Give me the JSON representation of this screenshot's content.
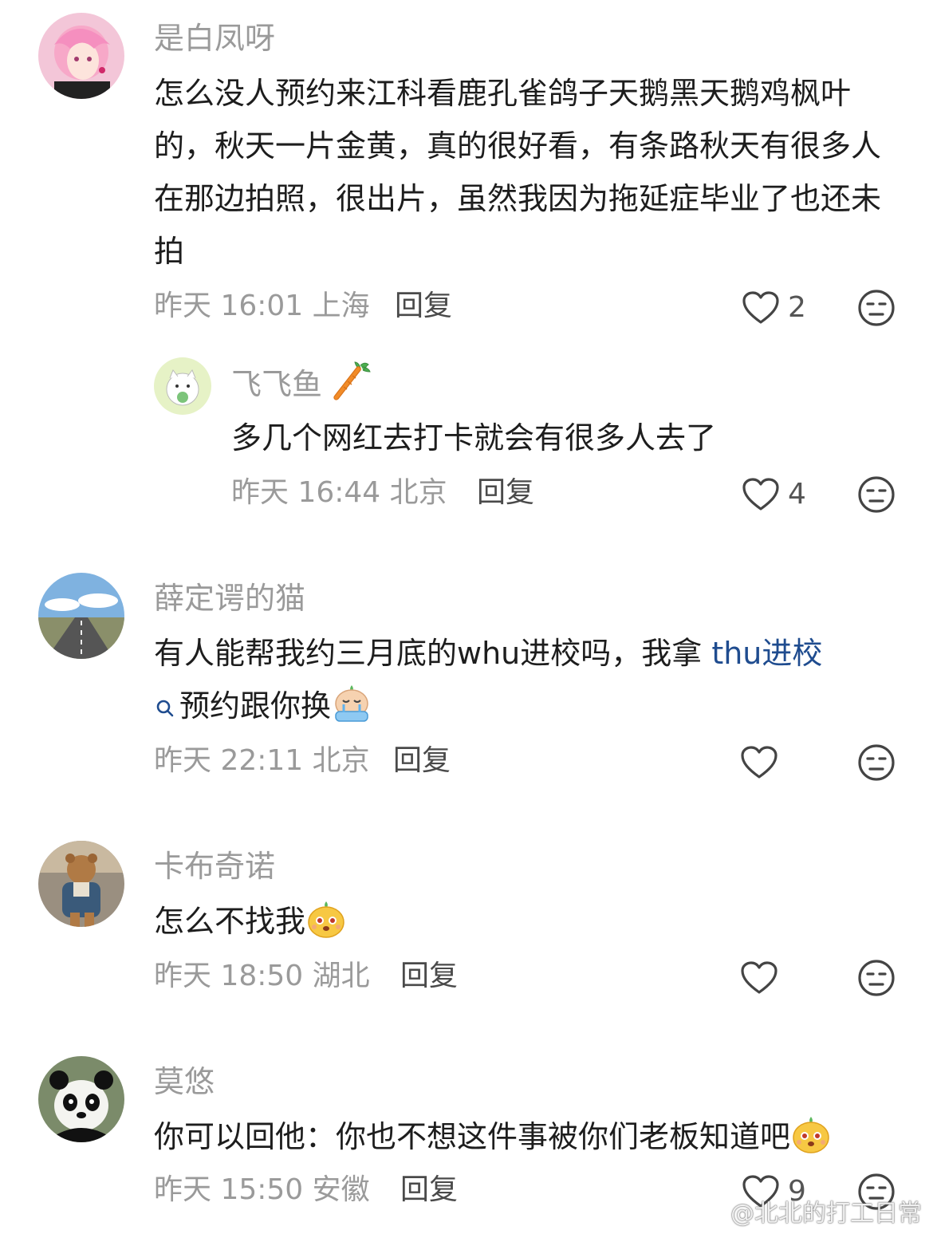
{
  "comments": [
    {
      "username": "是白凤呀",
      "text": "怎么没人预约来江科看鹿孔雀鸽子天鹅黑天鹅鸡枫叶的，秋天一片金黄，真的很好看，有条路秋天有很多人在那边拍照，很出片，虽然我因为拖延症毕业了也还未拍",
      "meta": "昨天 16:01 上海",
      "reply": "回复",
      "likes": "2"
    },
    {
      "username": "飞飞鱼",
      "text": "多几个网红去打卡就会有很多人去了",
      "meta": "昨天 16:44 北京",
      "reply": "回复",
      "likes": "4"
    },
    {
      "username": "薛定谔的猫",
      "text_before": "有人能帮我约三月底的whu进校吗，我拿 ",
      "link_text": "thu进校",
      "text_after": "预约跟你换",
      "meta": "昨天 22:11 北京",
      "reply": "回复",
      "likes": ""
    },
    {
      "username": "卡布奇诺",
      "text": "怎么不找我",
      "meta": "昨天 18:50 湖北",
      "reply": "回复",
      "likes": ""
    },
    {
      "username": "莫悠",
      "text": "你可以回他：你也不想这件事被你们老板知道吧",
      "meta": "昨天 15:50 安徽",
      "reply": "回复",
      "likes": "9"
    }
  ],
  "watermark": "@北北的打工日常",
  "colors": {
    "meta_gray": "#9a9a9a",
    "link_blue": "#1f4c8f"
  }
}
